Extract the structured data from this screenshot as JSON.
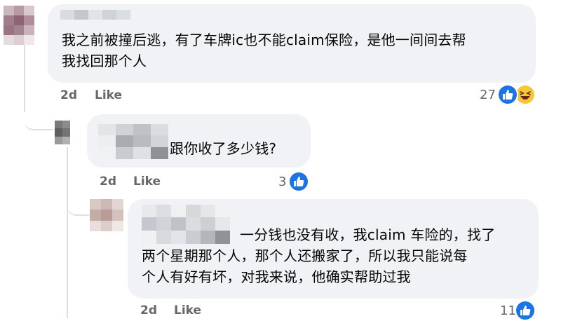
{
  "comments": [
    {
      "text": "我之前被撞后逃，有了车牌ic也不能claim保险，是他一间间去帮\n我找回那个人",
      "time": "2d",
      "like_label": "Like",
      "reaction_count": "27",
      "reactions": [
        "like-icon",
        "haha-icon"
      ]
    },
    {
      "text": "跟你收了多少钱?",
      "time": "2d",
      "like_label": "Like",
      "reaction_count": "3",
      "reactions": [
        "like-icon"
      ]
    },
    {
      "text": "一分钱也没有收，我claim 车险的，找了\n两个星期那个人，那个人还搬家了，所以我只能说每\n个人有好有坏，对我来说，他确实帮助过我",
      "time": "2d",
      "like_label": "Like",
      "reaction_count": "11",
      "reactions": [
        "like-icon"
      ]
    }
  ],
  "colors": {
    "bubble": "#f0f2f5",
    "meta_text": "#65676b",
    "like_blue": "#1b74e4",
    "haha_yellow": "#f7c63d"
  }
}
